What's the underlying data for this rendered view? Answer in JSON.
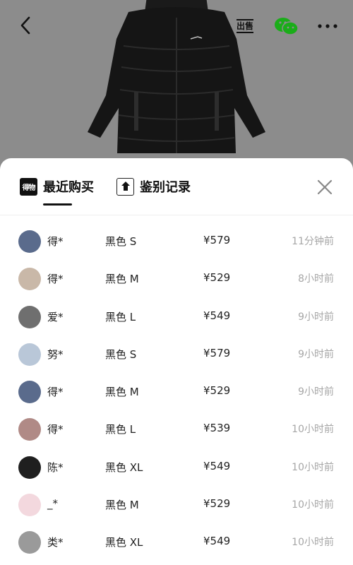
{
  "header": {
    "sell_label": "出售",
    "icons": [
      "back-icon",
      "sell-icon",
      "wechat-icon",
      "more-icon"
    ]
  },
  "tabs": [
    {
      "logo": "得物",
      "label": "最近购买",
      "active": true
    },
    {
      "logo_icon": "shield-icon",
      "label": "鉴别记录",
      "active": false
    }
  ],
  "purchases": [
    {
      "user": "得*",
      "spec": "黑色 S",
      "price": "¥579",
      "time": "11分钟前",
      "avatar_color": "#5a6b8c"
    },
    {
      "user": "得*",
      "spec": "黑色 M",
      "price": "¥529",
      "time": "8小时前",
      "avatar_color": "#c9b8a8"
    },
    {
      "user": "爱*",
      "spec": "黑色 L",
      "price": "¥549",
      "time": "9小时前",
      "avatar_color": "#6f6f6f"
    },
    {
      "user": "努*",
      "spec": "黑色 S",
      "price": "¥579",
      "time": "9小时前",
      "avatar_color": "#b9c7d8"
    },
    {
      "user": "得*",
      "spec": "黑色 M",
      "price": "¥529",
      "time": "9小时前",
      "avatar_color": "#5a6b8c"
    },
    {
      "user": "得*",
      "spec": "黑色 L",
      "price": "¥539",
      "time": "10小时前",
      "avatar_color": "#b08a86"
    },
    {
      "user": "陈*",
      "spec": "黑色 XL",
      "price": "¥549",
      "time": "10小时前",
      "avatar_color": "#1f1f1f"
    },
    {
      "user": "_*",
      "spec": "黑色 M",
      "price": "¥529",
      "time": "10小时前",
      "avatar_color": "#f3d8de"
    },
    {
      "user": "类*",
      "spec": "黑色 XL",
      "price": "¥549",
      "time": "10小时前",
      "avatar_color": "#9a9a9a"
    }
  ]
}
